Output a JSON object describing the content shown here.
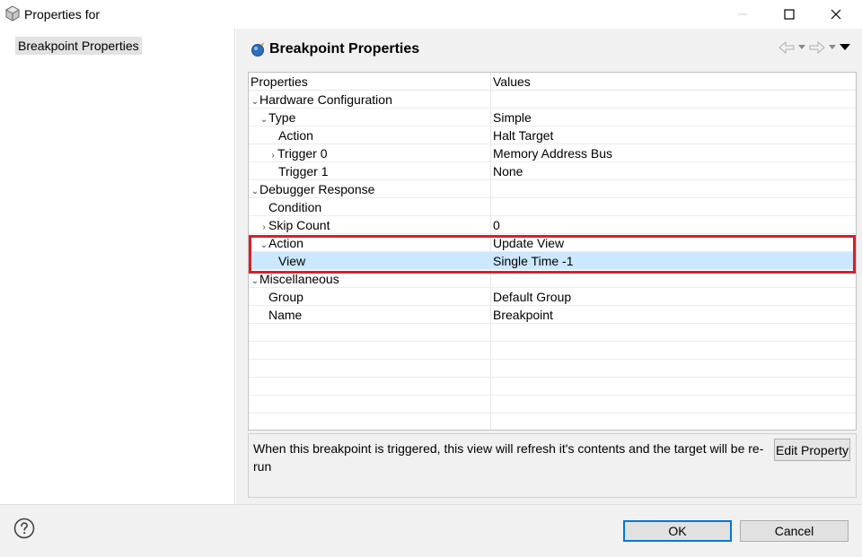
{
  "window": {
    "title": "Properties for",
    "icons": {
      "app": "gear-cube-icon",
      "minimize": "minimize-icon",
      "maximize": "maximize-icon",
      "close": "close-icon"
    }
  },
  "sidebar": {
    "items": [
      {
        "label": "Breakpoint Properties"
      }
    ]
  },
  "page": {
    "title": "Breakpoint Properties",
    "icon": "breakpoint-icon"
  },
  "table": {
    "headers": {
      "property": "Properties",
      "value": "Values"
    },
    "rows": [
      {
        "label": "Hardware Configuration",
        "value": "",
        "toggle": "expanded"
      },
      {
        "label": "Type",
        "value": "Simple",
        "toggle": "expanded"
      },
      {
        "label": "Action",
        "value": "Halt Target",
        "toggle": ""
      },
      {
        "label": "Trigger 0",
        "value": "Memory Address Bus",
        "toggle": "collapsed"
      },
      {
        "label": "Trigger 1",
        "value": "None",
        "toggle": ""
      },
      {
        "label": "Debugger Response",
        "value": "",
        "toggle": "expanded"
      },
      {
        "label": "Condition",
        "value": "",
        "toggle": ""
      },
      {
        "label": "Skip Count",
        "value": "0",
        "toggle": "collapsed"
      },
      {
        "label": "Action",
        "value": "Update View",
        "toggle": "expanded"
      },
      {
        "label": "View",
        "value": "Single Time -1",
        "toggle": "",
        "selected": true
      },
      {
        "label": "Miscellaneous",
        "value": "",
        "toggle": "expanded"
      },
      {
        "label": "Group",
        "value": "Default Group",
        "toggle": ""
      },
      {
        "label": "Name",
        "value": "Breakpoint",
        "toggle": ""
      }
    ]
  },
  "description": {
    "text": "When this breakpoint is triggered, this view will refresh it's contents and the target will be re-run",
    "edit_label": "Edit Property"
  },
  "footer": {
    "ok_label": "OK",
    "cancel_label": "Cancel"
  },
  "colors": {
    "selection": "#cce8ff",
    "highlight": "#d6202a",
    "default_button_border": "#0078d7"
  }
}
